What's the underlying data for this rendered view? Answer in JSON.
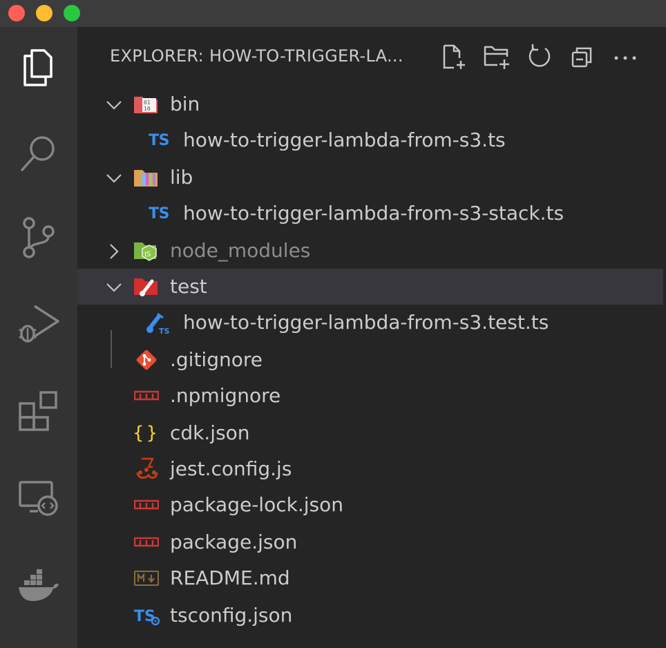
{
  "window": {
    "traffic_lights": [
      "close",
      "minimize",
      "maximize"
    ],
    "colors": {
      "close": "#ff5f57",
      "minimize": "#febc2e",
      "maximize": "#28c840"
    }
  },
  "activity_bar": [
    {
      "id": "explorer",
      "icon": "files-icon",
      "active": true
    },
    {
      "id": "search",
      "icon": "search-icon"
    },
    {
      "id": "source-control",
      "icon": "source-control-icon"
    },
    {
      "id": "run-debug",
      "icon": "run-debug-icon"
    },
    {
      "id": "extensions",
      "icon": "extensions-icon"
    },
    {
      "id": "remote-explorer",
      "icon": "remote-explorer-icon"
    },
    {
      "id": "docker",
      "icon": "docker-icon"
    }
  ],
  "explorer": {
    "title": "EXPLORER: HOW-TO-TRIGGER-LA...",
    "actions": [
      "new-file-icon",
      "new-folder-icon",
      "refresh-icon",
      "collapse-all-icon",
      "more-icon"
    ],
    "items": [
      {
        "label": "bin",
        "type": "folder",
        "expanded": true,
        "icon": "folder-bin-icon",
        "depth": 0
      },
      {
        "label": "how-to-trigger-lambda-from-s3.ts",
        "type": "file",
        "icon": "typescript-icon",
        "depth": 1
      },
      {
        "label": "lib",
        "type": "folder",
        "expanded": true,
        "icon": "folder-lib-icon",
        "depth": 0
      },
      {
        "label": "how-to-trigger-lambda-from-s3-stack.ts",
        "type": "file",
        "icon": "typescript-icon",
        "depth": 1
      },
      {
        "label": "node_modules",
        "type": "folder",
        "expanded": false,
        "icon": "folder-node-icon",
        "depth": 0,
        "dimmed": true
      },
      {
        "label": "test",
        "type": "folder",
        "expanded": true,
        "icon": "folder-test-icon",
        "depth": 0,
        "selected": true
      },
      {
        "label": "how-to-trigger-lambda-from-s3.test.ts",
        "type": "file",
        "icon": "test-ts-icon",
        "depth": 1
      },
      {
        "label": ".gitignore",
        "type": "file",
        "icon": "git-icon",
        "depth": 0
      },
      {
        "label": ".npmignore",
        "type": "file",
        "icon": "npm-icon",
        "depth": 0
      },
      {
        "label": "cdk.json",
        "type": "file",
        "icon": "json-icon",
        "depth": 0
      },
      {
        "label": "jest.config.js",
        "type": "file",
        "icon": "jest-icon",
        "depth": 0
      },
      {
        "label": "package-lock.json",
        "type": "file",
        "icon": "npm-icon",
        "depth": 0
      },
      {
        "label": "package.json",
        "type": "file",
        "icon": "npm-icon",
        "depth": 0
      },
      {
        "label": "README.md",
        "type": "file",
        "icon": "markdown-icon",
        "depth": 0
      },
      {
        "label": "tsconfig.json",
        "type": "file",
        "icon": "tsconfig-icon",
        "depth": 0
      }
    ]
  },
  "colors": {
    "background": "#252526",
    "activity_bar": "#333333",
    "titlebar": "#3c3c3c",
    "selection": "#37373d",
    "text": "#cccccc",
    "typescript": "#3b8eea",
    "npm": "#cb3837",
    "json_braces": "#f5d32b"
  }
}
